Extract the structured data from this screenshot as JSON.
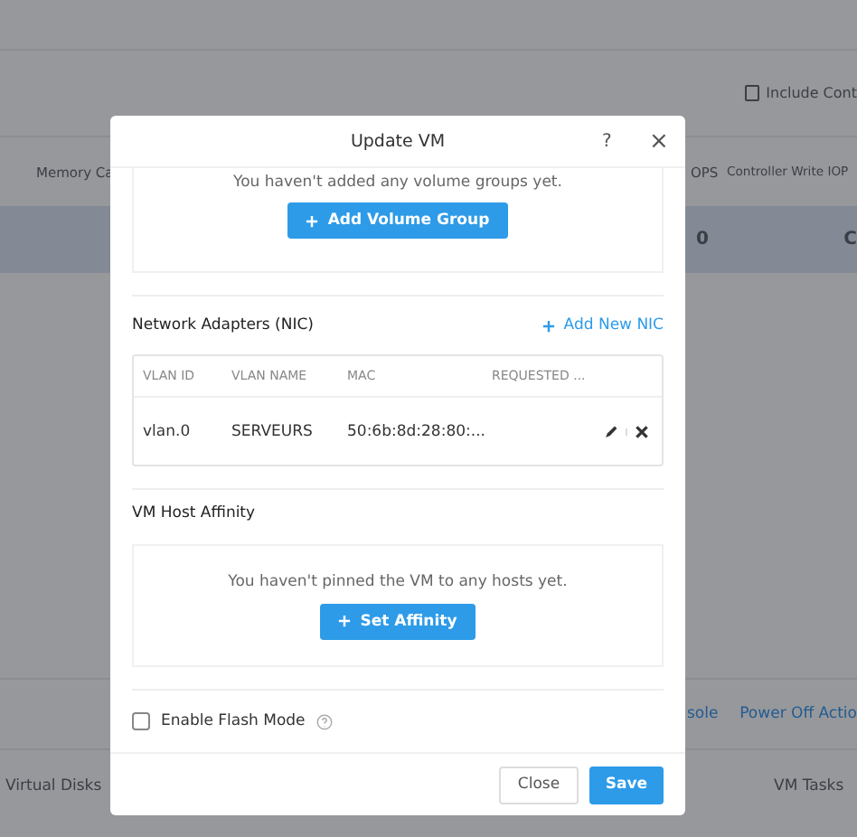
{
  "background": {
    "include_option": {
      "label": "Include Cont",
      "checked": false
    },
    "columns": [
      "Memory Ca",
      "OPS",
      "Controller Write IOP"
    ],
    "row": {
      "selected": true,
      "cells": [
        "0",
        "C"
      ]
    },
    "links": [
      "sole",
      "Power Off Actio"
    ],
    "tabs": [
      "Virtual Disks",
      "VM Tasks"
    ]
  },
  "dialog": {
    "title": "Update VM",
    "help": "?",
    "close": "×",
    "volume_groups": {
      "empty_text": "You haven't added any volume groups yet.",
      "button": "Add Volume Group"
    },
    "nic": {
      "title": "Network Adapters (NIC)",
      "add_link": "Add New NIC",
      "columns": [
        "VLAN ID",
        "VLAN NAME",
        "MAC",
        "REQUESTED ..."
      ],
      "rows": [
        {
          "cells": [
            "vlan.0",
            "SERVEURS",
            "50:6b:8d:28:80:..."
          ]
        }
      ]
    },
    "affinity": {
      "title": "VM Host Affinity",
      "empty_text": "You haven't pinned the VM to any hosts yet.",
      "button": "Set Affinity"
    },
    "flash_mode": {
      "label": "Enable Flash Mode",
      "checked": false
    },
    "buttons": [
      {
        "label": "Close",
        "kind": "secondary"
      },
      {
        "label": "Save",
        "kind": "primary"
      }
    ]
  }
}
